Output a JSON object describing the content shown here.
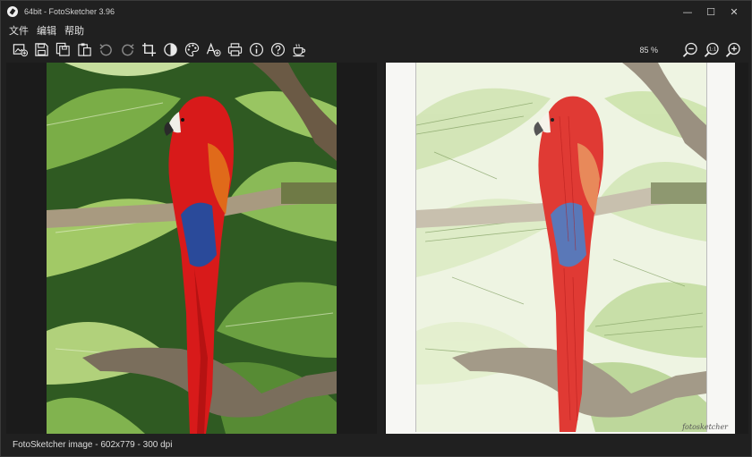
{
  "window": {
    "title": "64bit - FotoSketcher 3.96",
    "controls": {
      "minimize": "—",
      "maximize": "☐",
      "close": "✕"
    }
  },
  "menu": {
    "items": [
      "文件",
      "编辑",
      "帮助"
    ]
  },
  "toolbar": {
    "buttons": [
      "open-image",
      "save",
      "save-as",
      "paste",
      "undo",
      "redo",
      "crop",
      "contrast",
      "palette",
      "add-text",
      "print",
      "info",
      "help",
      "coffee"
    ]
  },
  "zoom": {
    "level": "85 %",
    "buttons": [
      "zoom-out",
      "zoom-actual",
      "zoom-in"
    ],
    "actual_label": "1:1"
  },
  "canvas": {
    "signature": "fotosketcher"
  },
  "status": {
    "text": "FotoSketcher image - 602x779 - 300 dpi"
  },
  "colors": {
    "background": "#202020",
    "pane": "#1b1b1b",
    "parrot_red": "#d81a1a",
    "parrot_blue": "#2a4a9a",
    "foliage": "#3c6b2a"
  }
}
